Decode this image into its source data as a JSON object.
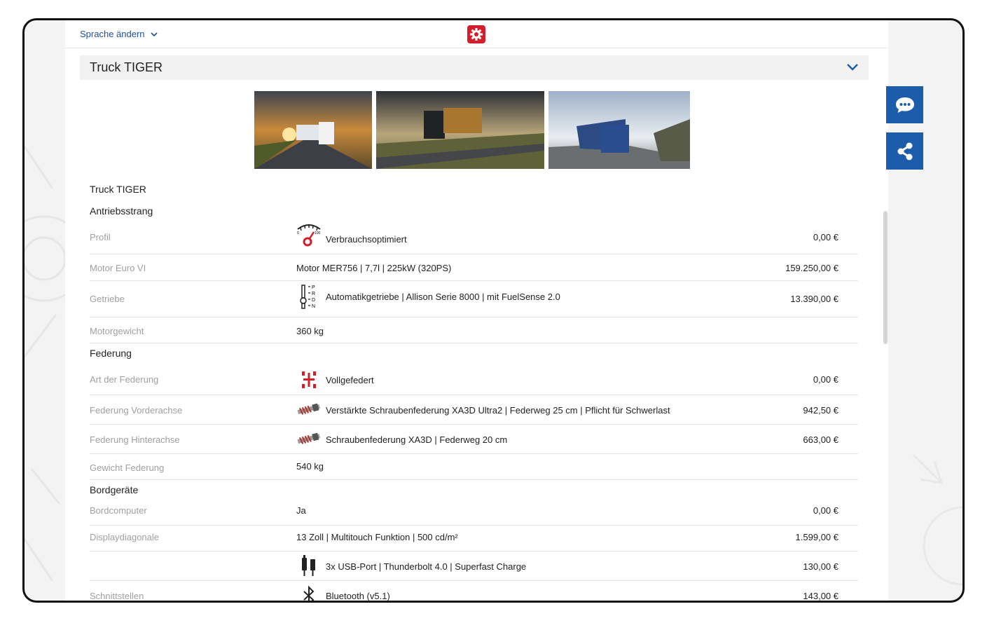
{
  "topbar": {
    "language_label": "Sprache ändern"
  },
  "header": {
    "title": "Truck TIGER"
  },
  "product": {
    "title": "Truck TIGER"
  },
  "sections": {
    "antriebsstrang": "Antriebsstrang",
    "federung": "Federung",
    "bordgeraete": "Bordgeräte"
  },
  "rows": {
    "profil": {
      "label": "Profil",
      "value": "Verbrauchsoptimiert",
      "price": "0,00 €"
    },
    "motor": {
      "label": "Motor Euro VI",
      "value": "Motor MER756 | 7,7l | 225kW (320PS)",
      "price": "159.250,00 €"
    },
    "getriebe": {
      "label": "Getriebe",
      "value": "Automatikgetriebe | Allison Serie 8000 | mit FuelSense 2.0",
      "price": "13.390,00 €"
    },
    "motorgewicht": {
      "label": "Motorgewicht",
      "value": "360 kg"
    },
    "art_federung": {
      "label": "Art der Federung",
      "value": "Vollgefedert",
      "price": "0,00 €"
    },
    "federung_vorne": {
      "label": "Federung Vorderachse",
      "value": "Verstärkte Schraubenfederung XA3D Ultra2 | Federweg 25 cm | Pflicht für Schwerlast",
      "price": "942,50 €"
    },
    "federung_hinten": {
      "label": "Federung Hinterachse",
      "value": "Schraubenfederung XA3D | Federweg 20 cm",
      "price": "663,00 €"
    },
    "gewicht_federung": {
      "label": "Gewicht Federung",
      "value": "540 kg"
    },
    "bordcomputer": {
      "label": "Bordcomputer",
      "value": "Ja",
      "price": "0,00 €"
    },
    "display": {
      "label": "Displaydiagonale",
      "value": "13 Zoll | Multitouch Funktion | 500 cd/m²",
      "price": "1.599,00 €"
    },
    "usb": {
      "value": "3x USB-Port | Thunderbolt 4.0 | Superfast Charge",
      "price": "130,00 €"
    },
    "schnittstellen": {
      "label": "Schnittstellen",
      "value": "Bluetooth (v5.1)",
      "price": "143,00 €"
    }
  },
  "gauge": {
    "min_label": "0",
    "max_label": "100"
  },
  "gear_letters": [
    "P",
    "R",
    "D",
    "N"
  ],
  "icons": {
    "logo": "gear-logo-icon",
    "chat": "chat-bubble-icon",
    "share": "share-icon"
  },
  "colors": {
    "accent": "#1c5dab",
    "brand": "#d11f2b",
    "link": "#1f4f9c"
  }
}
